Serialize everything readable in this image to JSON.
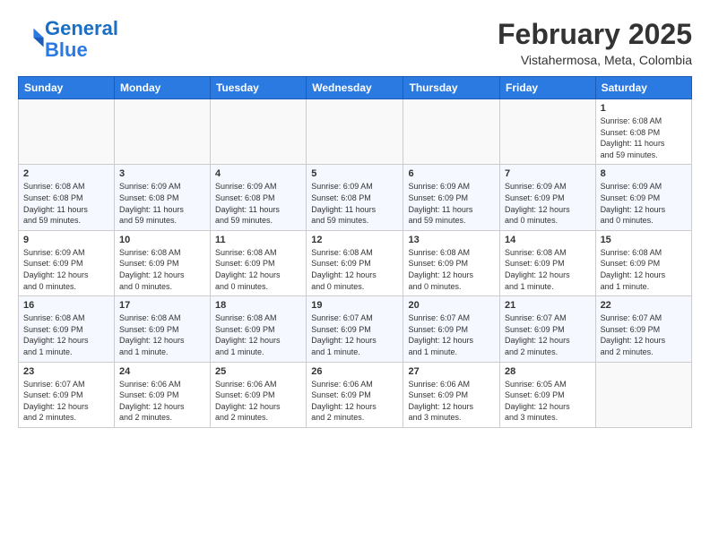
{
  "header": {
    "logo_line1": "General",
    "logo_line2": "Blue",
    "month": "February 2025",
    "location": "Vistahermosa, Meta, Colombia"
  },
  "weekdays": [
    "Sunday",
    "Monday",
    "Tuesday",
    "Wednesday",
    "Thursday",
    "Friday",
    "Saturday"
  ],
  "weeks": [
    [
      {
        "day": "",
        "info": ""
      },
      {
        "day": "",
        "info": ""
      },
      {
        "day": "",
        "info": ""
      },
      {
        "day": "",
        "info": ""
      },
      {
        "day": "",
        "info": ""
      },
      {
        "day": "",
        "info": ""
      },
      {
        "day": "1",
        "info": "Sunrise: 6:08 AM\nSunset: 6:08 PM\nDaylight: 11 hours\nand 59 minutes."
      }
    ],
    [
      {
        "day": "2",
        "info": "Sunrise: 6:08 AM\nSunset: 6:08 PM\nDaylight: 11 hours\nand 59 minutes."
      },
      {
        "day": "3",
        "info": "Sunrise: 6:09 AM\nSunset: 6:08 PM\nDaylight: 11 hours\nand 59 minutes."
      },
      {
        "day": "4",
        "info": "Sunrise: 6:09 AM\nSunset: 6:08 PM\nDaylight: 11 hours\nand 59 minutes."
      },
      {
        "day": "5",
        "info": "Sunrise: 6:09 AM\nSunset: 6:08 PM\nDaylight: 11 hours\nand 59 minutes."
      },
      {
        "day": "6",
        "info": "Sunrise: 6:09 AM\nSunset: 6:09 PM\nDaylight: 11 hours\nand 59 minutes."
      },
      {
        "day": "7",
        "info": "Sunrise: 6:09 AM\nSunset: 6:09 PM\nDaylight: 12 hours\nand 0 minutes."
      },
      {
        "day": "8",
        "info": "Sunrise: 6:09 AM\nSunset: 6:09 PM\nDaylight: 12 hours\nand 0 minutes."
      }
    ],
    [
      {
        "day": "9",
        "info": "Sunrise: 6:09 AM\nSunset: 6:09 PM\nDaylight: 12 hours\nand 0 minutes."
      },
      {
        "day": "10",
        "info": "Sunrise: 6:08 AM\nSunset: 6:09 PM\nDaylight: 12 hours\nand 0 minutes."
      },
      {
        "day": "11",
        "info": "Sunrise: 6:08 AM\nSunset: 6:09 PM\nDaylight: 12 hours\nand 0 minutes."
      },
      {
        "day": "12",
        "info": "Sunrise: 6:08 AM\nSunset: 6:09 PM\nDaylight: 12 hours\nand 0 minutes."
      },
      {
        "day": "13",
        "info": "Sunrise: 6:08 AM\nSunset: 6:09 PM\nDaylight: 12 hours\nand 0 minutes."
      },
      {
        "day": "14",
        "info": "Sunrise: 6:08 AM\nSunset: 6:09 PM\nDaylight: 12 hours\nand 1 minute."
      },
      {
        "day": "15",
        "info": "Sunrise: 6:08 AM\nSunset: 6:09 PM\nDaylight: 12 hours\nand 1 minute."
      }
    ],
    [
      {
        "day": "16",
        "info": "Sunrise: 6:08 AM\nSunset: 6:09 PM\nDaylight: 12 hours\nand 1 minute."
      },
      {
        "day": "17",
        "info": "Sunrise: 6:08 AM\nSunset: 6:09 PM\nDaylight: 12 hours\nand 1 minute."
      },
      {
        "day": "18",
        "info": "Sunrise: 6:08 AM\nSunset: 6:09 PM\nDaylight: 12 hours\nand 1 minute."
      },
      {
        "day": "19",
        "info": "Sunrise: 6:07 AM\nSunset: 6:09 PM\nDaylight: 12 hours\nand 1 minute."
      },
      {
        "day": "20",
        "info": "Sunrise: 6:07 AM\nSunset: 6:09 PM\nDaylight: 12 hours\nand 1 minute."
      },
      {
        "day": "21",
        "info": "Sunrise: 6:07 AM\nSunset: 6:09 PM\nDaylight: 12 hours\nand 2 minutes."
      },
      {
        "day": "22",
        "info": "Sunrise: 6:07 AM\nSunset: 6:09 PM\nDaylight: 12 hours\nand 2 minutes."
      }
    ],
    [
      {
        "day": "23",
        "info": "Sunrise: 6:07 AM\nSunset: 6:09 PM\nDaylight: 12 hours\nand 2 minutes."
      },
      {
        "day": "24",
        "info": "Sunrise: 6:06 AM\nSunset: 6:09 PM\nDaylight: 12 hours\nand 2 minutes."
      },
      {
        "day": "25",
        "info": "Sunrise: 6:06 AM\nSunset: 6:09 PM\nDaylight: 12 hours\nand 2 minutes."
      },
      {
        "day": "26",
        "info": "Sunrise: 6:06 AM\nSunset: 6:09 PM\nDaylight: 12 hours\nand 2 minutes."
      },
      {
        "day": "27",
        "info": "Sunrise: 6:06 AM\nSunset: 6:09 PM\nDaylight: 12 hours\nand 3 minutes."
      },
      {
        "day": "28",
        "info": "Sunrise: 6:05 AM\nSunset: 6:09 PM\nDaylight: 12 hours\nand 3 minutes."
      },
      {
        "day": "",
        "info": ""
      }
    ]
  ]
}
